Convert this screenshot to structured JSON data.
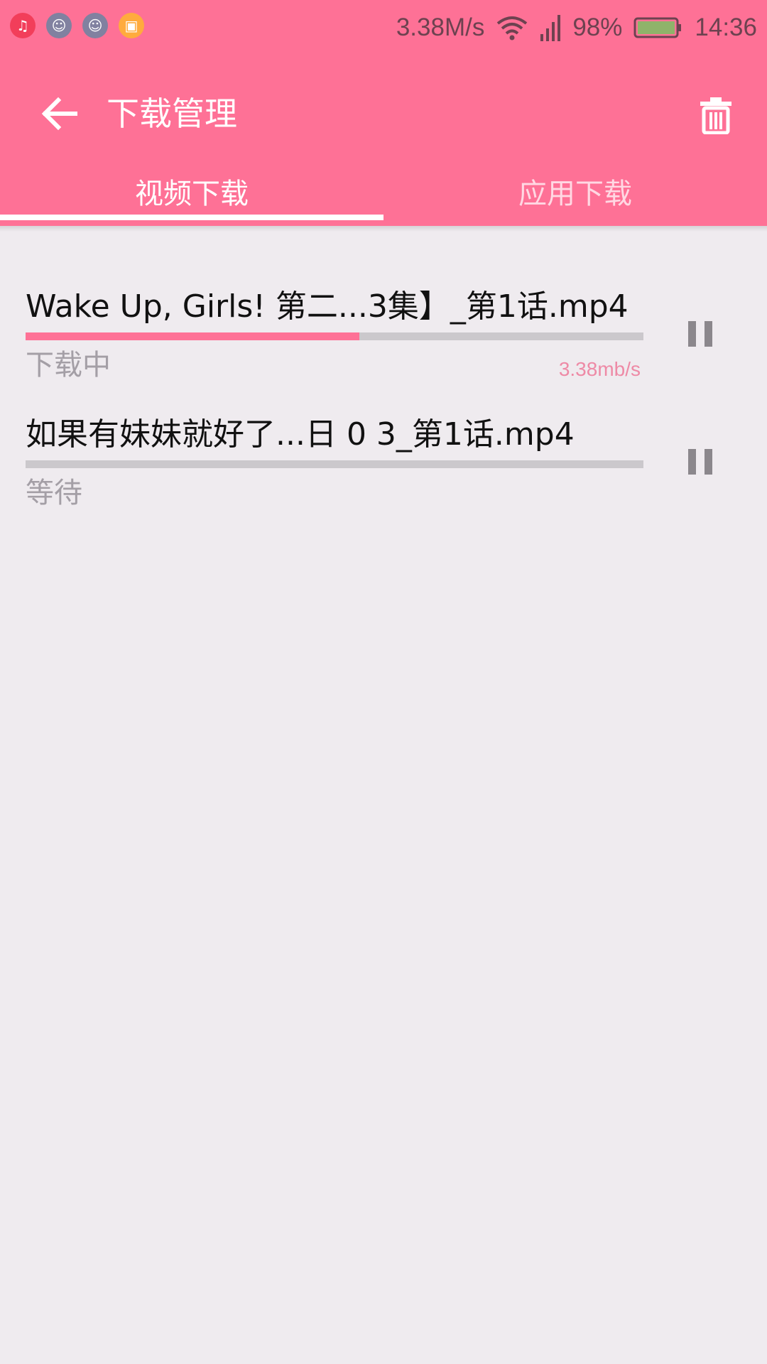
{
  "status_bar": {
    "notification_icons": [
      {
        "name": "music-app-icon",
        "color": "#f23e5a",
        "glyph": "♫"
      },
      {
        "name": "robot-app-icon",
        "color": "#8181a0",
        "glyph": "☺"
      },
      {
        "name": "robot-app-icon",
        "color": "#8181a0",
        "glyph": "☺"
      },
      {
        "name": "slides-app-icon",
        "color": "#ffab3d",
        "glyph": "▣"
      }
    ],
    "net_speed": "3.38M/s",
    "battery": "98%",
    "time": "14:36"
  },
  "app_bar": {
    "title": "下载管理",
    "back_icon": "arrow-left-icon",
    "trash_icon": "trash-icon"
  },
  "tabs": [
    {
      "label": "视频下载",
      "active": true
    },
    {
      "label": "应用下载",
      "active": false
    }
  ],
  "downloads": [
    {
      "name": "Wake Up, Girls! 第二...3集】_第1话.mp4",
      "status": "下载中",
      "speed": "3.38mb/s",
      "progress": 0.54
    },
    {
      "name": "如果有妹妹就好了...日 0 3_第1话.mp4",
      "status": "等待",
      "speed": "",
      "progress": 0
    }
  ],
  "colors": {
    "accent": "#fe7196",
    "background": "#efebef",
    "progress_track": "#cbc8cc",
    "speed_text": "#ee8aa6",
    "status_text": "#a49fa6"
  }
}
